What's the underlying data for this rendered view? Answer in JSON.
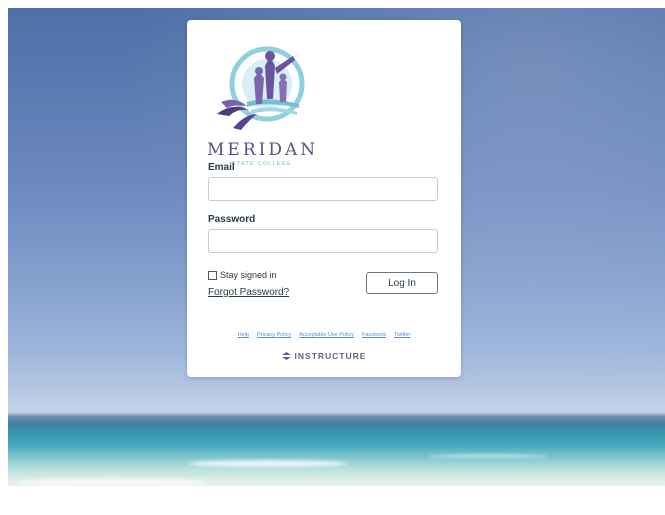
{
  "logo": {
    "name": "MERIDAN",
    "subtitle": "STATE COLLEGE"
  },
  "form": {
    "email_label": "Email",
    "email_value": "",
    "password_label": "Password",
    "password_value": "",
    "stay_signed_in_label": "Stay signed in",
    "stay_signed_in_checked": false,
    "forgot_label": "Forgot Password?",
    "login_label": "Log In"
  },
  "footer": {
    "links": [
      "Help",
      "Privacy Policy",
      "Acceptable Use Policy",
      "Facebook",
      "Twitter"
    ],
    "brand": "INSTRUCTURE"
  },
  "colors": {
    "brand_purple": "#6b5a8e",
    "logo_teal": "#6fb5c8",
    "link_blue": "#5a8fc7"
  }
}
